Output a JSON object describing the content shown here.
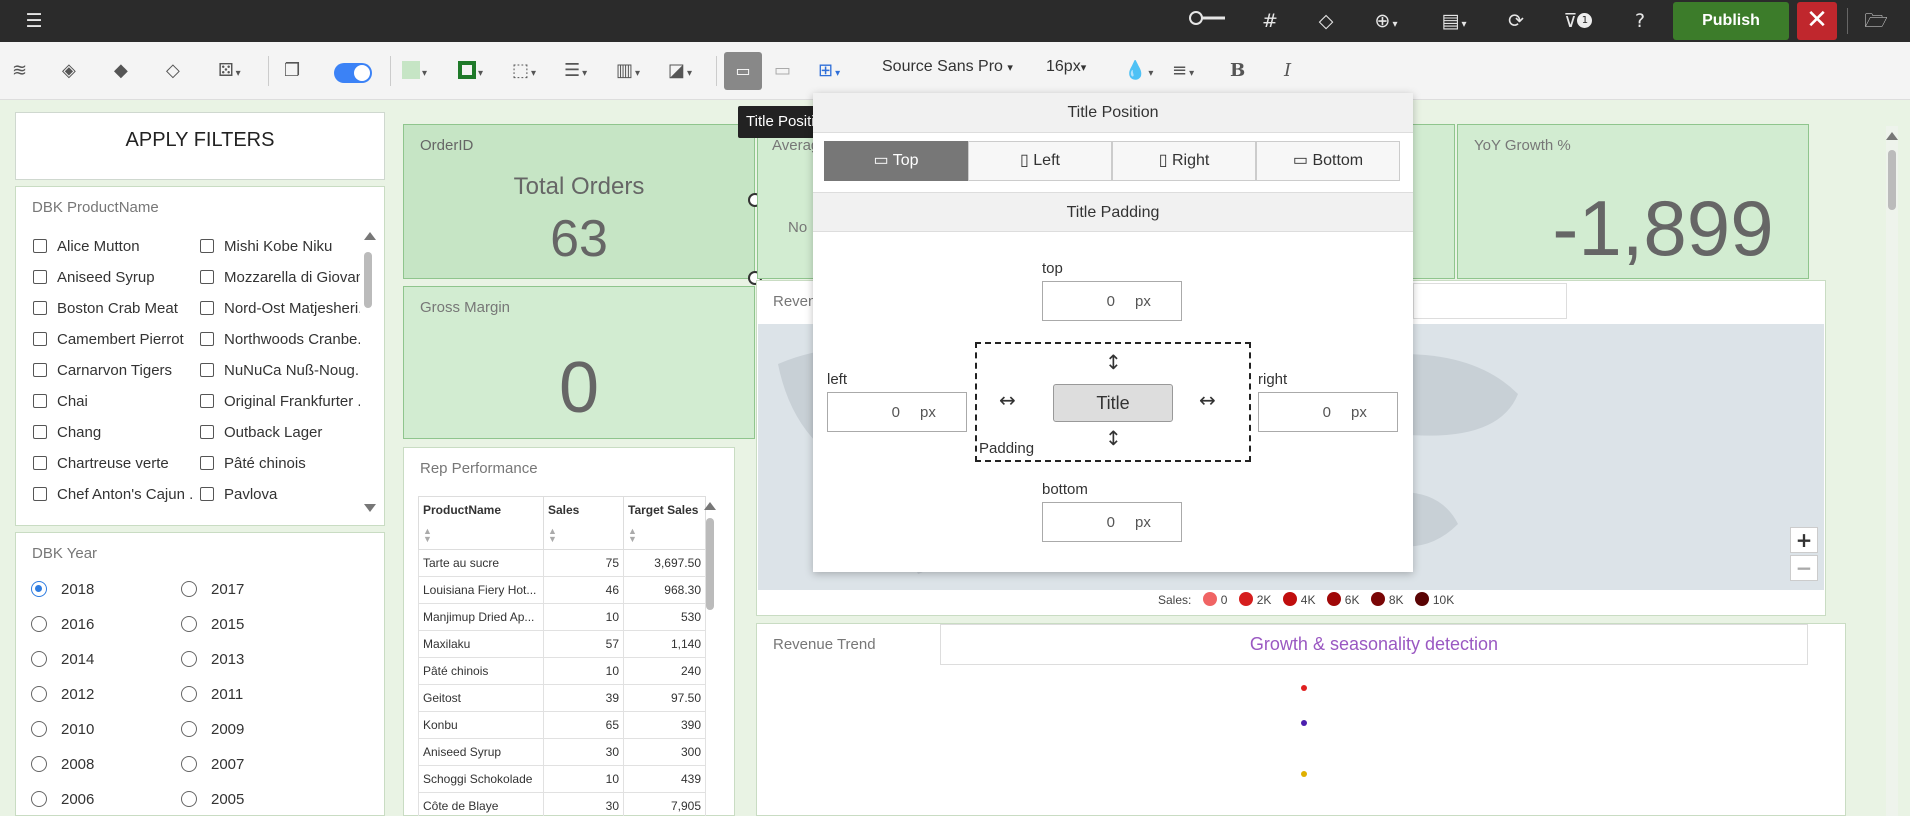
{
  "topbar": {
    "publish_label": "Publish",
    "filter_badge": "1",
    "icons": [
      "hamburger-icon",
      "slider-icon",
      "grid-hash-icon",
      "diamond-icon",
      "add-circle-icon",
      "page-icon",
      "refresh-icon",
      "filter-icon",
      "help-icon",
      "close-icon",
      "folder-open-icon"
    ]
  },
  "toolbar": {
    "font_family": "Source Sans Pro",
    "font_size": "16px",
    "tooltip": "Title Position"
  },
  "filters": {
    "apply_label": "APPLY FILTERS",
    "product": {
      "title": "DBK ProductName",
      "col1": [
        "Alice Mutton",
        "Aniseed Syrup",
        "Boston Crab Meat",
        "Camembert Pierrot",
        "Carnarvon Tigers",
        "Chai",
        "Chang",
        "Chartreuse verte",
        "Chef Anton's Cajun ..."
      ],
      "col2": [
        "Mishi Kobe Niku",
        "Mozzarella di Giovan",
        "Nord-Ost Matjesheri...",
        "Northwoods Cranbe...",
        "NuNuCa Nuß-Noug...",
        "Original Frankfurter ...",
        "Outback Lager",
        "Pâté chinois",
        "Pavlova"
      ]
    },
    "year": {
      "title": "DBK Year",
      "col1": [
        "2018",
        "2016",
        "2014",
        "2012",
        "2010",
        "2008",
        "2006"
      ],
      "col2": [
        "2017",
        "2015",
        "2013",
        "2011",
        "2009",
        "2007",
        "2005"
      ],
      "selected": "2018"
    }
  },
  "kpis": {
    "orders": {
      "title": "OrderID",
      "label": "Total Orders",
      "value": "63"
    },
    "average": {
      "title": "Averag",
      "sub": "No"
    },
    "gross": {
      "title": "Gross Margin",
      "value": "0"
    },
    "yoy": {
      "title": "YoY Growth %",
      "value": "-1,899"
    }
  },
  "rep": {
    "title": "Rep Performance",
    "columns": [
      "ProductName",
      "Sales",
      "Target Sales"
    ],
    "rows": [
      [
        "Tarte au sucre",
        "75",
        "3,697.50"
      ],
      [
        "Louisiana Fiery Hot...",
        "46",
        "968.30"
      ],
      [
        "Manjimup Dried Ap...",
        "10",
        "530"
      ],
      [
        "Maxilaku",
        "57",
        "1,140"
      ],
      [
        "Pâté chinois",
        "10",
        "240"
      ],
      [
        "Geitost",
        "39",
        "97.50"
      ],
      [
        "Konbu",
        "65",
        "390"
      ],
      [
        "Aniseed Syrup",
        "30",
        "300"
      ],
      [
        "Schoggi Schokolade",
        "10",
        "439"
      ],
      [
        "Côte de Blaye",
        "30",
        "7,905"
      ]
    ]
  },
  "revenue_map": {
    "title": "Reven",
    "legend_title": "Sales:",
    "legend": [
      {
        "label": "0",
        "color": "#f06464"
      },
      {
        "label": "2K",
        "color": "#d61e1e"
      },
      {
        "label": "4K",
        "color": "#c00e0e"
      },
      {
        "label": "6K",
        "color": "#a00808"
      },
      {
        "label": "8K",
        "color": "#7a0606"
      },
      {
        "label": "10K",
        "color": "#5a0404"
      }
    ],
    "zoom_in": "+",
    "zoom_out": "−"
  },
  "revenue_trend": {
    "title": "Revenue Trend",
    "subtitle": "Growth & seasonality detection"
  },
  "popup": {
    "position_header": "Title Position",
    "options": [
      "Top",
      "Left",
      "Right",
      "Bottom"
    ],
    "selected": "Top",
    "padding_header": "Title Padding",
    "top_label": "top",
    "top_value": "0",
    "left_label": "left",
    "left_value": "0",
    "right_label": "right",
    "right_value": "0",
    "bottom_label": "bottom",
    "bottom_value": "0",
    "unit": "px",
    "preview_title": "Title",
    "preview_caption": "Padding"
  }
}
